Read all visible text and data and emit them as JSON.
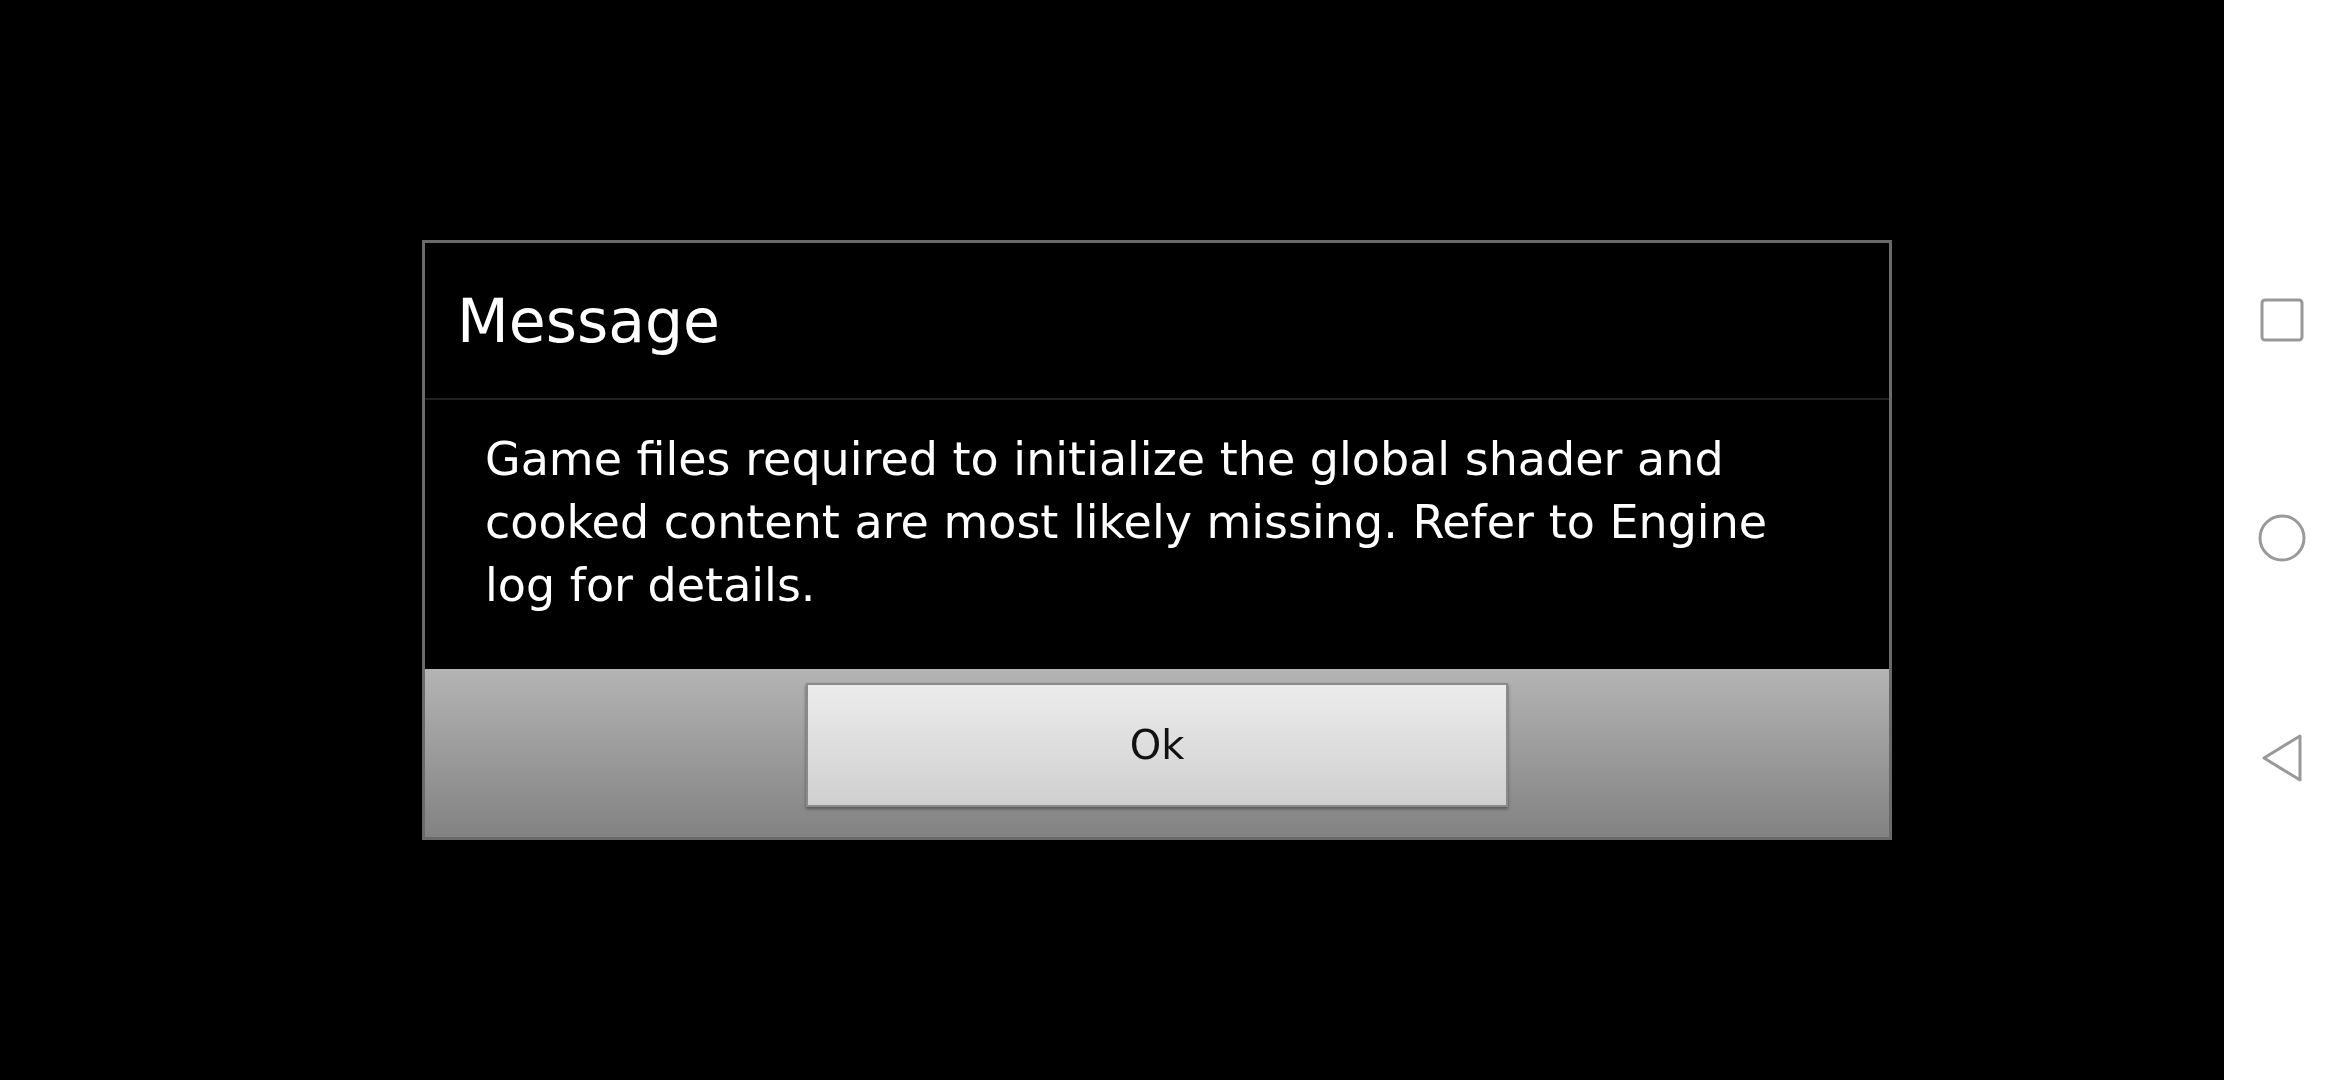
{
  "dialog": {
    "title": "Message",
    "message": "Game files required to initialize the global shader and cooked content are most likely missing. Refer to Engine log for details.",
    "buttons": [
      "Ok"
    ]
  },
  "nav_bar": {
    "buttons": [
      {
        "kind": "recents"
      },
      {
        "kind": "home"
      },
      {
        "kind": "back"
      }
    ]
  }
}
